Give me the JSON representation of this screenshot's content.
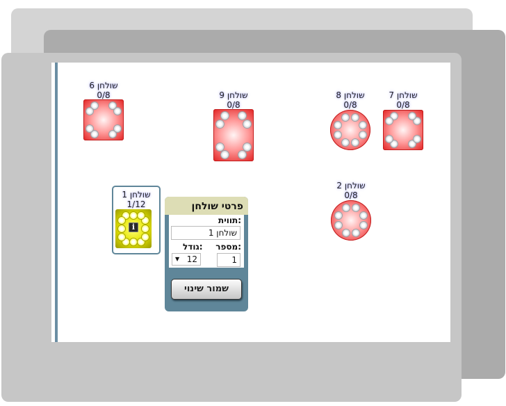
{
  "tables": {
    "t6": {
      "name": "שולחן 6",
      "count": "0/8"
    },
    "t9": {
      "name": "שולחן 9",
      "count": "0/8"
    },
    "t8": {
      "name": "שולחן 8",
      "count": "0/8"
    },
    "t7": {
      "name": "שולחן 7",
      "count": "0/8"
    },
    "t2": {
      "name": "שולחן 2",
      "count": "0/8"
    },
    "t1": {
      "name": "שולחן 1",
      "count": "1/12"
    }
  },
  "panel": {
    "title": "פרטי שולחן",
    "label_caption": "תווית:",
    "label_value": "שולחן 1",
    "number_caption": "מספר:",
    "number_value": "1",
    "size_caption": "גודל:",
    "size_value": "12",
    "save_label": "שמור שינוי"
  },
  "info_glyph": "i",
  "colors": {
    "table_empty": "#e22222",
    "table_selected": "#e5e500",
    "panel_frame": "#5f8699",
    "panel_header": "#ddddb5"
  },
  "icons": {
    "seat": "seat-icon",
    "info": "info-icon",
    "dropdown": "chevron-down-icon"
  }
}
